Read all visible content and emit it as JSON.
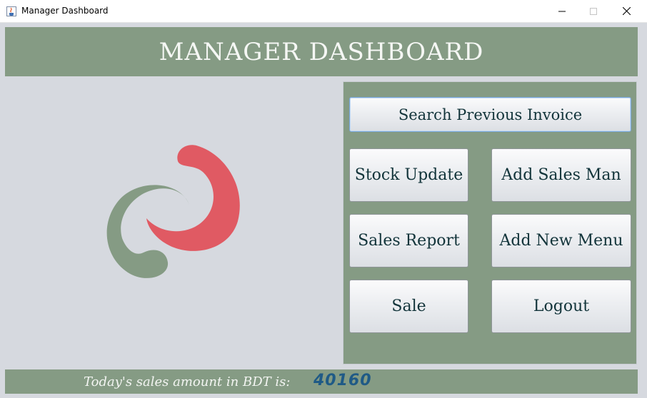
{
  "window": {
    "title": "Manager Dashboard",
    "icon": "java-cup-icon"
  },
  "header": {
    "title": "MANAGER DASHBOARD"
  },
  "logo": {
    "icon": "swirl-logo",
    "colors": {
      "green": "#859b84",
      "red": "#e05a63"
    }
  },
  "buttons": {
    "search_invoice": "Search Previous Invoice",
    "stock_update": "Stock Update",
    "add_sales_man": "Add Sales Man",
    "sales_report": "Sales Report",
    "add_new_menu": "Add New Menu",
    "sale": "Sale",
    "logout": "Logout"
  },
  "footer": {
    "label": "Today's sales  amount in BDT is:",
    "amount": "40160"
  },
  "colors": {
    "accent": "#859b84",
    "background": "#d6d9df",
    "amount": "#1f5a86",
    "button_text": "#12343a"
  }
}
